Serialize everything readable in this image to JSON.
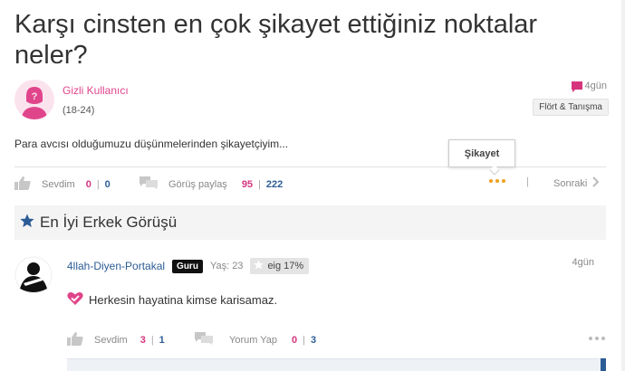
{
  "question": {
    "title": "Karşı cinsten en çok şikayet ettiğiniz noktalar neler?",
    "asker_name": "Gizli Kullanıcı",
    "asker_age": "(18-24)",
    "time": "4gün",
    "category": "Flört & Tanışma",
    "body": "Para avcısı olduğumuzu düşünmelerinden şikayetçiyim..."
  },
  "question_actions": {
    "like_label": "Sevdim",
    "like_female": "0",
    "like_male": "0",
    "share_label": "Görüş paylaş",
    "share_female": "95",
    "share_male": "222",
    "separator": "|",
    "next_label": "Sonraki",
    "tooltip": "Şikayet"
  },
  "section": {
    "title": "En İyi Erkek Görüşü"
  },
  "answer": {
    "name": "4llah-Diyen-Portakal",
    "badge": "Guru",
    "age": "Yaş: 23",
    "similarity": "eig 17%",
    "time": "4gün",
    "text": "Herkesin hayatina kimse karisamaz."
  },
  "answer_actions": {
    "like_label": "Sevdim",
    "like_female": "3",
    "like_male": "1",
    "reply_label": "Yorum Yap",
    "reply_female": "0",
    "reply_male": "3",
    "separator": "|"
  },
  "colors": {
    "pink": "#d6357e",
    "blue": "#2c5c96",
    "orange": "#f0a01e"
  }
}
